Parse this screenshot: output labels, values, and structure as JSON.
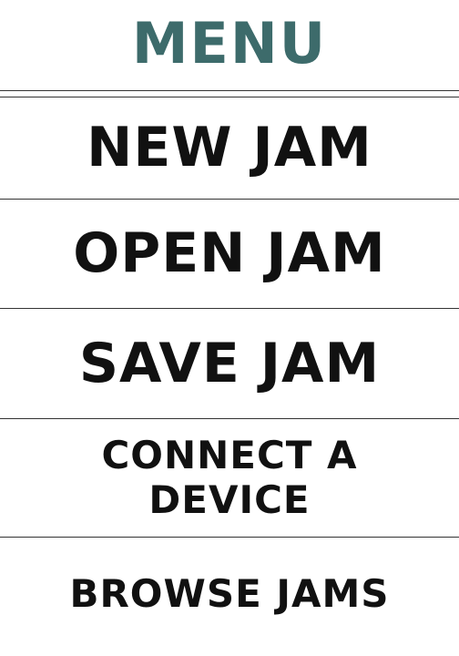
{
  "header": {
    "title": "MENU",
    "title_color": "#3d6b6b"
  },
  "menu": {
    "new_jam": "NEW JAM",
    "open_jam": "OPEN JAM",
    "save_jam": "SAVE JAM",
    "connect_device": "CONNECT A\nDEVICE",
    "browse_jams": "BROWSE JAMS"
  },
  "colors": {
    "text": "#111111",
    "divider": "#333333",
    "background": "#ffffff"
  }
}
